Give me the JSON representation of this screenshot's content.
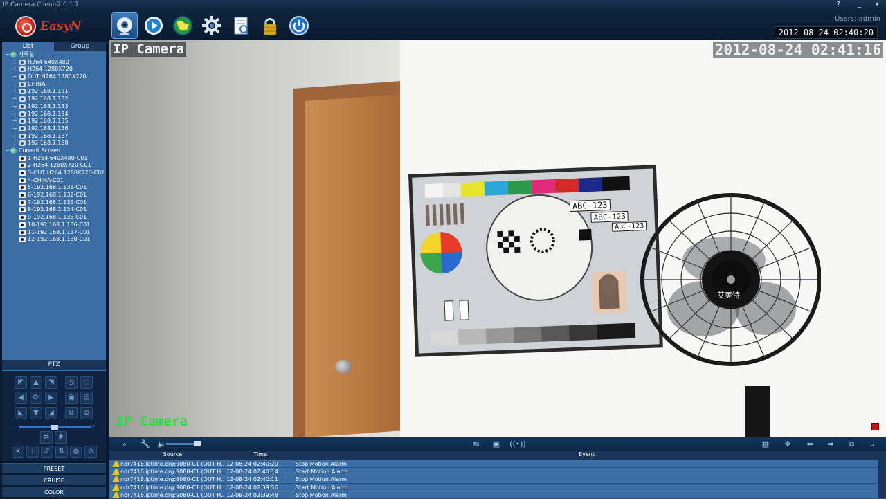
{
  "window": {
    "title": "IP Camera Client-2.0.1.7",
    "help": "?",
    "minimize": "_",
    "close": "x"
  },
  "toolbar": {
    "brand": "EasyN",
    "buttons": [
      "live-view",
      "playback",
      "e-map",
      "settings",
      "log",
      "lock",
      "power"
    ],
    "users_label": "Users: admin",
    "datetime": "2012-08-24 02:40:20"
  },
  "sidebar": {
    "tabs": [
      "List",
      "Group"
    ],
    "groups": [
      {
        "label": "사무실",
        "items": [
          "H264 640X480",
          "H264 1280X720",
          "OUT H264 1280X720",
          "CHINA",
          "192.168.1.131",
          "192.168.1.132",
          "192.168.1.133",
          "192.168.1.134",
          "192.168.1.135",
          "192.168.1.136",
          "192.168.1.137",
          "192.168.1.138"
        ]
      },
      {
        "label": "Current Screen",
        "items": [
          "1-H264 640X480-C01",
          "2-H264 1280X720-C01",
          "3-OUT H264 1280X720-C01",
          "4-CHINA-C01",
          "5-192.168.1.131-C01",
          "6-192.168.1.132-C01",
          "7-192.168.1.133-C01",
          "8-192.168.1.134-C01",
          "9-192.168.1.135-C01",
          "10-192.168.1.136-C01",
          "11-192.168.1.137-C01",
          "12-192.168.1.138-C01"
        ]
      }
    ],
    "ptz_label": "PTZ",
    "ptz_speed_minus": "-",
    "ptz_speed_plus": "+",
    "ptz_speed_value": 50,
    "bottom_buttons": [
      "PRESET",
      "CRUISE",
      "COLOR"
    ]
  },
  "video": {
    "osd_name": "IP Camera",
    "osd_time": "2012-08-24 02:41:16",
    "osd_bottom": "IP Camera",
    "chart_labels": [
      "ABC-123",
      "ABC-123",
      "ABC-123"
    ],
    "fan_brand": "艾美特",
    "record_color": "#d01010"
  },
  "events": {
    "columns": [
      "Source",
      "Time",
      "Event"
    ],
    "rows": [
      {
        "source": "ndr7416.iptime.org:9080-C1 (OUT H...",
        "time": "12-08-24 02:40:20",
        "event": "Stop Motion Alarm"
      },
      {
        "source": "ndr7416.iptime.org:9080-C1 (OUT H...",
        "time": "12-08-24 02:40:14",
        "event": "Start Motion Alarm"
      },
      {
        "source": "ndr7416.iptime.org:9080-C1 (OUT H...",
        "time": "12-08-24 02:40:11",
        "event": "Stop Motion Alarm"
      },
      {
        "source": "ndr7416.iptime.org:9080-C1 (OUT H...",
        "time": "12-08-24 02:39:56",
        "event": "Start Motion Alarm"
      },
      {
        "source": "ndr7416.iptime.org:9080-C1 (OUT H...",
        "time": "12-08-24 02:39:48",
        "event": "Stop Motion Alarm"
      }
    ]
  },
  "colors": {
    "accent": "#3b6ea5",
    "background": "#0a1a2e",
    "osd_green": "#23e33a",
    "warning": "#f3c21a"
  }
}
